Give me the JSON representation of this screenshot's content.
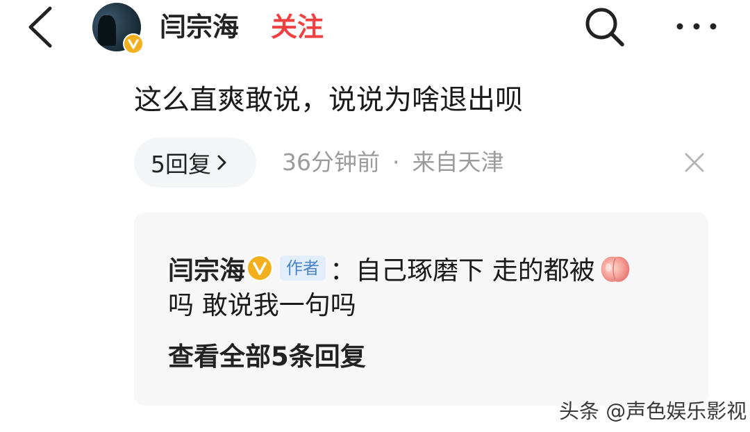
{
  "header": {
    "username": "闫宗海",
    "follow_label": "关注",
    "icons": {
      "back": "back-arrow-icon",
      "search": "search-icon",
      "more": "more-dots-icon",
      "verified": "verified-v-badge-icon"
    },
    "colors": {
      "follow": "#f04142",
      "verified": "#f2b01e"
    }
  },
  "comment": {
    "text": "这么直爽敢说，说说为啥退出呗",
    "reply_count_label": "5回复",
    "time": "36分钟前",
    "separator": "·",
    "location": "来自天津"
  },
  "reply": {
    "author": "闫宗海",
    "author_tag": "作者",
    "colon": "：",
    "line1": "自己琢磨下 走的都被",
    "emoji": "peach-emoji",
    "line2": "吗 敢说我一句吗",
    "view_all_label": "查看全部5条回复"
  },
  "watermark": "头条 @声色娱乐影视"
}
